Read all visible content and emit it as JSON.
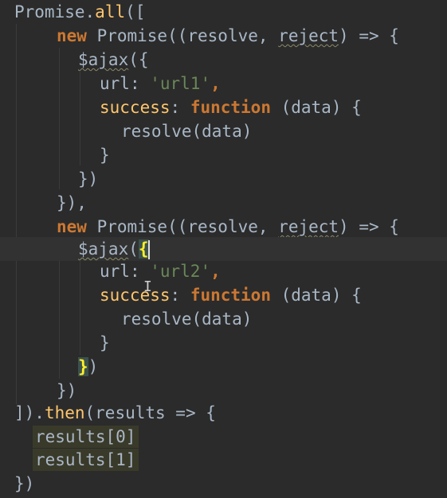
{
  "editor": {
    "background": "#2b2b2b",
    "lines": [
      {
        "t1": "Promise",
        "t2": ".",
        "t3": "all",
        "t4": "(["
      },
      {
        "kw": "new ",
        "cls": "Promise",
        "a": "((resolve, ",
        "b": "reject",
        "c": ") => {"
      },
      {
        "fn": "$ajax",
        "rest": "({"
      },
      {
        "key": "url",
        "colon": ": ",
        "str": "'url1'",
        "end": ","
      },
      {
        "key": "success",
        "colon": ": ",
        "kw": "function",
        "rest": " (data) {"
      },
      {
        "call": "resolve(data)"
      },
      {
        "text": "}"
      },
      {
        "text": "})"
      },
      {
        "text": "}),",
        "comma": ","
      },
      {
        "kw": "new ",
        "cls": "Promise",
        "a": "((resolve, ",
        "b": "reject",
        "c": ") => {"
      },
      {
        "fn": "$ajax",
        "rest": "(",
        "brace": "{"
      },
      {
        "key": "url",
        "colon": ": ",
        "str": "'url2'",
        "end": ","
      },
      {
        "key": "success",
        "colon": ": ",
        "kw": "function",
        "rest": " (data) {"
      },
      {
        "call": "resolve(data)"
      },
      {
        "text": "}"
      },
      {
        "brace": "}",
        "rest": ")"
      },
      {
        "text": "})"
      },
      {
        "a": "]).",
        "then": "then",
        "b": "(results => {"
      },
      {
        "text": "results[0]"
      },
      {
        "text": "results[1]"
      },
      {
        "text": "})"
      }
    ]
  }
}
